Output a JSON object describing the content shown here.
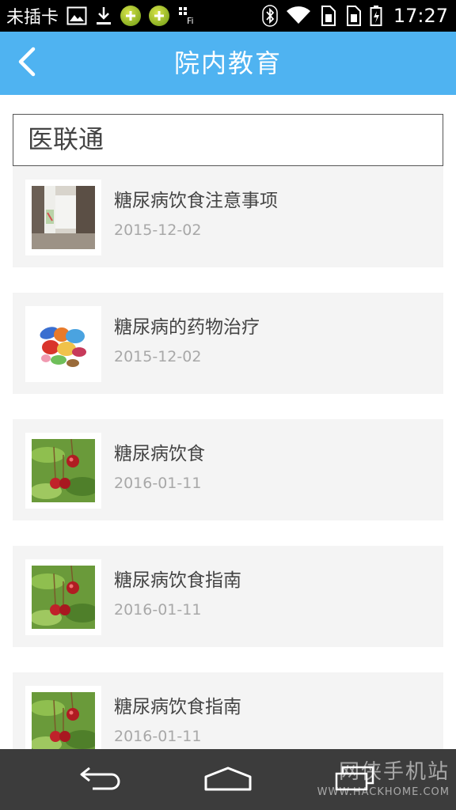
{
  "status_bar": {
    "carrier": "未插卡",
    "time": "17:27",
    "icons": [
      "image-icon",
      "download-icon",
      "app-green-icon",
      "app-green-icon",
      "wifi-hotspot-icon",
      "bluetooth-icon",
      "wifi-icon",
      "sim-icon",
      "sim-icon",
      "battery-icon"
    ]
  },
  "app_bar": {
    "title": "院内教育",
    "back_icon": "chevron-left-icon",
    "background_color": "#4fb3f1"
  },
  "section": {
    "title": "医联通"
  },
  "articles": [
    {
      "title": "糖尿病饮食注意事项",
      "date": "2015-12-02",
      "thumbnail": "room-photo"
    },
    {
      "title": "糖尿病的药物治疗",
      "date": "2015-12-02",
      "thumbnail": "pills-photo"
    },
    {
      "title": "糖尿病饮食",
      "date": "2016-01-11",
      "thumbnail": "cherries-photo"
    },
    {
      "title": "糖尿病饮食指南",
      "date": "2016-01-11",
      "thumbnail": "cherries-photo"
    },
    {
      "title": "糖尿病饮食指南",
      "date": "2016-01-11",
      "thumbnail": "cherries-photo"
    }
  ],
  "nav_bar": {
    "buttons": [
      "back-arrow-icon",
      "home-icon",
      "recent-apps-icon"
    ],
    "watermark": "网侠手机站",
    "watermark_url": "WWW.HACKHOME.COM"
  }
}
